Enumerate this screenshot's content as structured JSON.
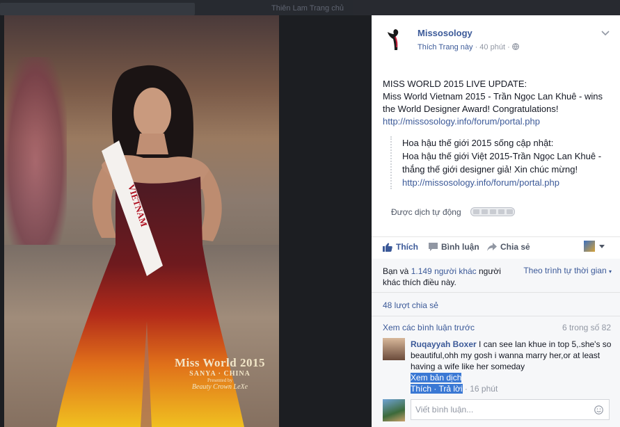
{
  "background": {
    "blurred_links": "Thiên Lam    Trang chủ"
  },
  "photo": {
    "sash_text": "VIETNAM",
    "watermark": {
      "title": "Miss World 2015",
      "location": "SANYA · CHINA",
      "presented": "Presented by",
      "brand": "Beauty Crown LeXe"
    }
  },
  "post": {
    "page_name": "Missosology",
    "like_page": "Thích Trang này",
    "time": "40 phút",
    "text": {
      "line1": "MISS WORLD 2015 LIVE UPDATE:",
      "line2": "Miss World Vietnam 2015 - Trần Ngọc Lan Khuê - wins the World Designer Award! Congratulations!",
      "link": "http://missosology.info/forum/portal.php"
    },
    "translation": {
      "line1": "Hoa hậu thế giới 2015 sống cập nhật:",
      "line2": "Hoa hậu thế giới Việt 2015-Trần Ngọc Lan Khuê - thắng thế giới designer giả! Xin chúc mừng!",
      "link": "http://missosology.info/forum/portal.php"
    },
    "auto_translated": "Được dịch tự động",
    "actions": {
      "like": "Thích",
      "comment": "Bình luận",
      "share": "Chia sẻ"
    },
    "likes_prefix": "Bạn và ",
    "likes_count": "1.149 người khác",
    "likes_suffix": " người khác thích điều này.",
    "sort": "Theo trình tự thời gian",
    "shares": "48 lượt chia sẻ",
    "more_comments": "Xem các bình luận trước",
    "comment_count": "6 trong số 82",
    "comment": {
      "author": "Ruqayyah Boxer",
      "text": "I can see lan khue in top 5,.she's so beautiful,ohh my gosh i wanna marry her,or at least having a wife like her someday",
      "see_translation": "Xem bản dịch",
      "like": "Thích",
      "reply": "Trả lời",
      "time": "16 phút"
    },
    "comment_placeholder": "Viết bình luận..."
  },
  "colors": {
    "link": "#3b5998",
    "meta": "#9197a3",
    "highlight": "#3a78d4"
  },
  "icons": [
    "chevron-down-icon",
    "globe-icon",
    "thumbs-up-icon",
    "comment-icon",
    "share-icon",
    "emoji-icon"
  ]
}
